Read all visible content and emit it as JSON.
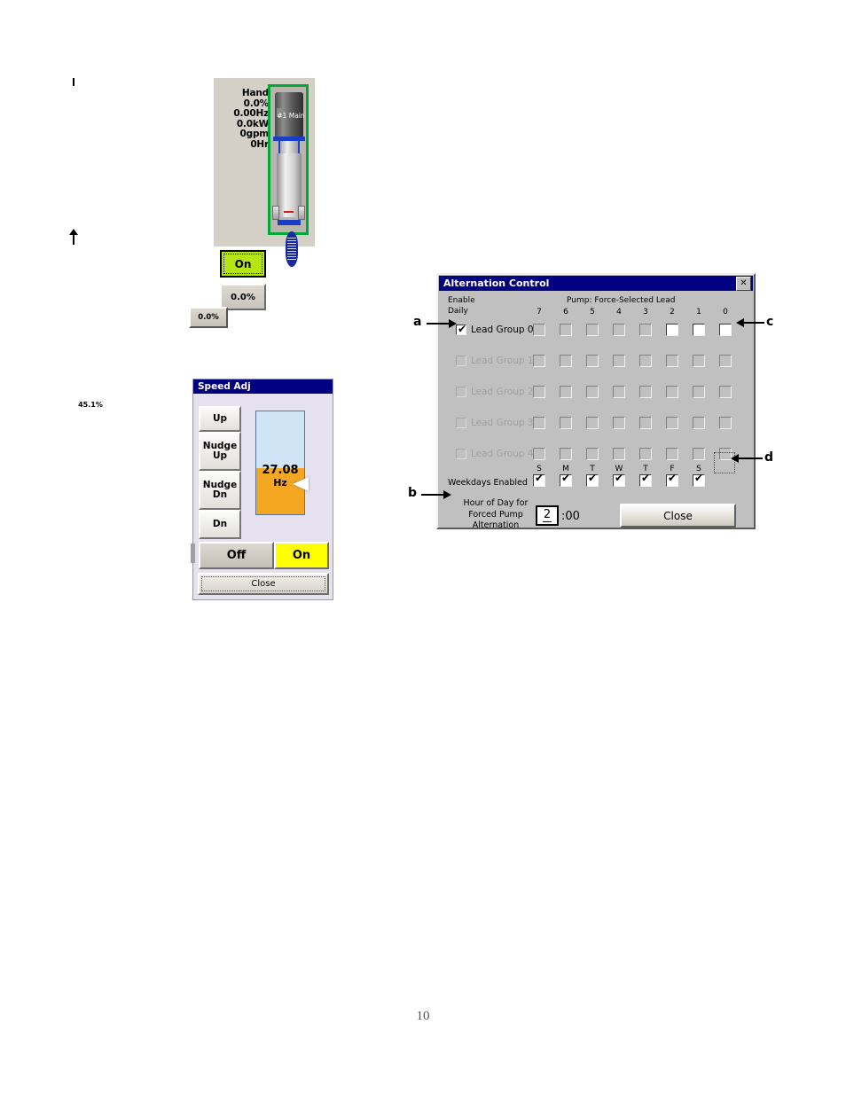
{
  "page": {
    "number": "10"
  },
  "pump_panel": {
    "readouts": [
      "Hand",
      "0.0%",
      "0.00Hz",
      "0.0kW",
      "0gpm",
      "0Hr"
    ],
    "mode": "Hand",
    "speed_percent": "0.0%",
    "frequency": "0.00Hz",
    "power": "0.0kW",
    "flow": "0gpm",
    "runtime": "0Hr",
    "on_button_label": "On",
    "percent_button_label": "0.0%",
    "pump_label": "#1 Main",
    "status_color": "#00a838",
    "on_color": "#b6e515"
  },
  "standalone_button": {
    "label": "0.0%"
  },
  "speed_adj": {
    "title": "Speed Adj",
    "buttons": [
      {
        "label": "Up"
      },
      {
        "label": "Nudge\nUp",
        "line1": "Nudge",
        "line2": "Up"
      },
      {
        "label": "Nudge\nDn",
        "line1": "Nudge",
        "line2": "Dn"
      },
      {
        "label": "Dn"
      }
    ],
    "up_label": "Up",
    "nudge_up_line1": "Nudge",
    "nudge_up_line2": "Up",
    "nudge_dn_line1": "Nudge",
    "nudge_dn_line2": "Dn",
    "dn_label": "Dn",
    "percent_label": "45.1%",
    "value": "27.08",
    "unit": "Hz",
    "gauge_fill_percent": 45.1,
    "gauge_fill_color": "#f5a623",
    "gauge_background_color": "#cfe4f5",
    "off_label": "Off",
    "on_label": "On",
    "on_color": "#ffff00",
    "close_label": "Close"
  },
  "alternation_control": {
    "title": "Alternation Control",
    "close_x": "✕",
    "enable_label_line1": "Enable",
    "enable_label_line2": "Daily",
    "pump_header": "Pump: Force-Selected Lead",
    "column_numbers": [
      "7",
      "6",
      "5",
      "4",
      "3",
      "2",
      "1",
      "0"
    ],
    "groups": [
      {
        "label": "Lead Group 0",
        "enabled": true,
        "checked": true,
        "pumps": [
          false,
          false,
          false,
          false,
          false,
          true,
          true,
          true
        ]
      },
      {
        "label": "Lead Group 1",
        "enabled": false,
        "checked": false,
        "pumps": [
          false,
          false,
          false,
          false,
          false,
          false,
          false,
          false
        ]
      },
      {
        "label": "Lead Group 2",
        "enabled": false,
        "checked": false,
        "pumps": [
          false,
          false,
          false,
          false,
          false,
          false,
          false,
          false
        ]
      },
      {
        "label": "Lead Group 3",
        "enabled": false,
        "checked": false,
        "pumps": [
          false,
          false,
          false,
          false,
          false,
          false,
          false,
          false
        ]
      },
      {
        "label": "Lead Group 4",
        "enabled": false,
        "checked": false,
        "pumps": [
          false,
          false,
          false,
          false,
          false,
          false,
          false,
          false
        ]
      }
    ],
    "weekdays_label": "Weekdays Enabled",
    "weekday_letters": [
      "S",
      "M",
      "T",
      "W",
      "T",
      "F",
      "S"
    ],
    "weekday_checked": [
      true,
      true,
      true,
      true,
      true,
      true,
      true
    ],
    "hour_label_line1": "Hour of Day for",
    "hour_label_line2": "Forced Pump",
    "hour_label_line3": "Alternation",
    "hour_value": "2",
    "hour_suffix": ":00",
    "close_label": "Close",
    "tick": "✔"
  },
  "callouts": {
    "a": "a",
    "b": "b",
    "c": "c",
    "d": "d"
  }
}
